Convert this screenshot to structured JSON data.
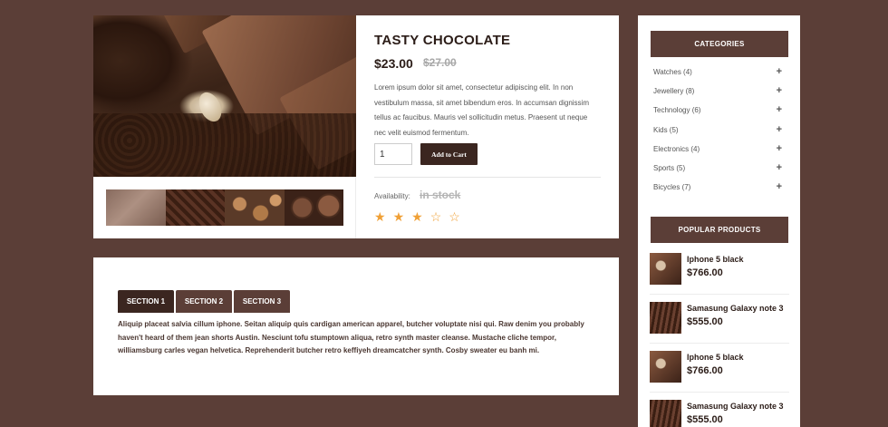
{
  "product": {
    "title": "TASTY CHOCOLATE",
    "price": "$23.00",
    "old_price": "$27.00",
    "description": "Lorem ipsum dolor sit amet, consectetur adipiscing elit. In non vestibulum massa, sit amet bibendum eros. In accumsan dignissim tellus ac faucibus. Mauris vel sollicitudin metus. Praesent ut neque nec velit euismod fermentum.",
    "quantity": "1",
    "add_to_cart_label": "Add to Cart",
    "availability_label": "Availability:",
    "availability_value": "in stock",
    "rating": 3,
    "rating_max": 5,
    "star_filled": "★",
    "star_empty": "☆"
  },
  "tabs": {
    "items": [
      {
        "label": "SECTION 1"
      },
      {
        "label": "SECTION 2"
      },
      {
        "label": "SECTION 3"
      }
    ],
    "active": 0,
    "content": "Aliquip placeat salvia cillum iphone. Seitan aliquip quis cardigan american apparel, butcher voluptate nisi qui. Raw denim you probably haven't heard of them jean shorts Austin. Nesciunt tofu stumptown aliqua, retro synth master cleanse. Mustache cliche tempor, williamsburg carles vegan helvetica. Reprehenderit butcher retro keffiyeh dreamcatcher synth. Cosby sweater eu banh mi."
  },
  "sidebar": {
    "categories_title": "CATEGORIES",
    "expand_glyph": "+",
    "categories": [
      {
        "label": "Watches (4)"
      },
      {
        "label": "Jewellery (8)"
      },
      {
        "label": "Technology (6)"
      },
      {
        "label": "Kids (5)"
      },
      {
        "label": "Electronics (4)"
      },
      {
        "label": "Sports (5)"
      },
      {
        "label": "Bicycles (7)"
      }
    ],
    "popular_title": "POPULAR PRODUCTS",
    "popular": [
      {
        "name": "Iphone 5 black",
        "price": "$766.00"
      },
      {
        "name": "Samasung Galaxy note 3",
        "price": "$555.00"
      },
      {
        "name": "Iphone 5 black",
        "price": "$766.00"
      },
      {
        "name": "Samasung Galaxy note 3",
        "price": "$555.00"
      }
    ]
  },
  "colors": {
    "background": "#5b3e37",
    "button_dark": "#3b2620",
    "star": "#f0a036"
  }
}
